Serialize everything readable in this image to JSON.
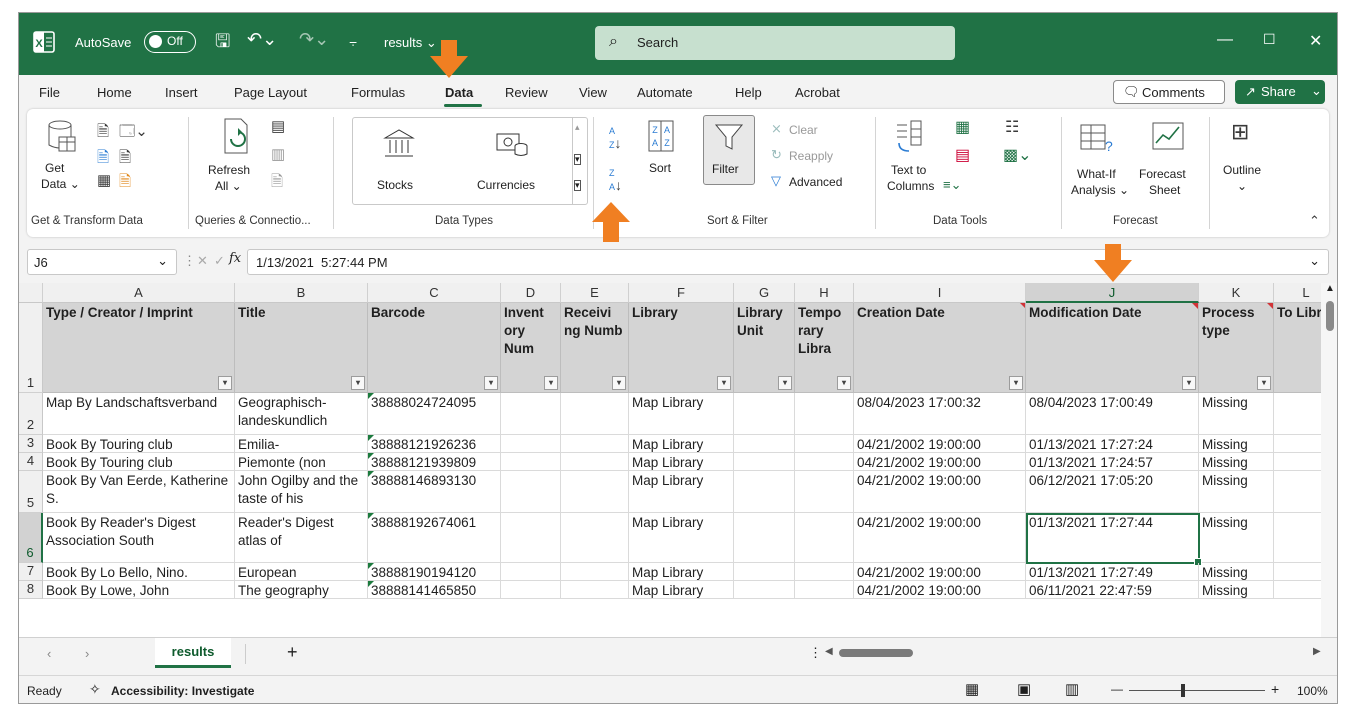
{
  "title_bar": {
    "autosave_label": "AutoSave",
    "autosave_state": "Off",
    "file_name": "results",
    "search_placeholder": "Search"
  },
  "menu": {
    "items": [
      "File",
      "Home",
      "Insert",
      "Page Layout",
      "Formulas",
      "Data",
      "Review",
      "View",
      "Automate",
      "Help",
      "Acrobat"
    ],
    "active": "Data",
    "comments_label": "Comments",
    "share_label": "Share"
  },
  "ribbon": {
    "get_data": "Get",
    "get_data_2": "Data",
    "refresh": "Refresh",
    "refresh_2": "All",
    "stocks": "Stocks",
    "currencies": "Currencies",
    "sort": "Sort",
    "filter": "Filter",
    "clear": "Clear",
    "reapply": "Reapply",
    "advanced": "Advanced",
    "text_to": "Text to",
    "columns": "Columns",
    "what_if": "What-If",
    "analysis": "Analysis",
    "forecast": "Forecast",
    "sheet": "Sheet",
    "outline": "Outline",
    "groups": {
      "get_transform": "Get & Transform Data",
      "queries": "Queries & Connectio...",
      "data_types": "Data Types",
      "sort_filter": "Sort & Filter",
      "data_tools": "Data Tools",
      "forecast": "Forecast"
    }
  },
  "formula_bar": {
    "name_box": "J6",
    "fx": "fx",
    "value": "1/13/2021  5:27:44 PM"
  },
  "columns": [
    "A",
    "B",
    "C",
    "D",
    "E",
    "F",
    "G",
    "H",
    "I",
    "J",
    "K",
    "L"
  ],
  "header_row": [
    "Type / Creator / Imprint",
    "Title",
    "Barcode",
    "Inventory Number",
    "Receiving Number",
    "Library",
    "Library Unit",
    "Temporary Library",
    "Creation Date",
    "Modification Date",
    "Process type",
    "To Library"
  ],
  "header_display": [
    "Type / Creator / Imprint",
    "Title",
    "Barcode",
    "Invent ory Num",
    "Receivi ng Numb",
    "Library",
    "Library Unit",
    "Tempo rary Libra",
    "Creation Date",
    "Modification Date",
    "Process type",
    "To Libra"
  ],
  "rows": [
    {
      "num": "2",
      "a": "Map By Landschaftsverband",
      "b": "Geographisch- landeskundlich",
      "c": "38888024724095",
      "f": "Map Library",
      "i": "08/04/2023 17:00:32",
      "j": "08/04/2023 17:00:49",
      "k": "Missing"
    },
    {
      "num": "3",
      "a": "Book By Touring club",
      "b": "Emilia-",
      "c": "38888121926236",
      "f": "Map Library",
      "i": "04/21/2002 19:00:00",
      "j": "01/13/2021 17:27:24",
      "k": "Missing"
    },
    {
      "num": "4",
      "a": "Book By Touring club",
      "b": "Piemonte (non",
      "c": "38888121939809",
      "f": "Map Library",
      "i": "04/21/2002 19:00:00",
      "j": "01/13/2021 17:24:57",
      "k": "Missing"
    },
    {
      "num": "5",
      "a": "Book By Van Eerde, Katherine S.",
      "b": "John Ogilby and the taste of his",
      "c": "38888146893130",
      "f": "Map Library",
      "i": "04/21/2002 19:00:00",
      "j": "06/12/2021 17:05:20",
      "k": "Missing"
    },
    {
      "num": "6",
      "a": "Book By Reader's Digest Association South",
      "b": "Reader's Digest atlas of",
      "c": "38888192674061",
      "f": "Map Library",
      "i": "04/21/2002 19:00:00",
      "j": "01/13/2021 17:27:44",
      "k": "Missing"
    },
    {
      "num": "7",
      "a": "Book By Lo Bello, Nino.",
      "b": "European",
      "c": "38888190194120",
      "f": "Map Library",
      "i": "04/21/2002 19:00:00",
      "j": "01/13/2021 17:27:49",
      "k": "Missing"
    },
    {
      "num": "8",
      "a": "Book By Lowe, John",
      "b": "The geography",
      "c": "38888141465850",
      "f": "Map Library",
      "i": "04/21/2002 19:00:00",
      "j": "06/11/2021 22:47:59",
      "k": "Missing"
    }
  ],
  "header_row_num": "1",
  "sheet_tab": "results",
  "status": {
    "ready": "Ready",
    "accessibility": "Accessibility: Investigate",
    "zoom": "100%"
  },
  "colors": {
    "excel_green": "#207245",
    "annotation_orange": "#f07f22"
  }
}
